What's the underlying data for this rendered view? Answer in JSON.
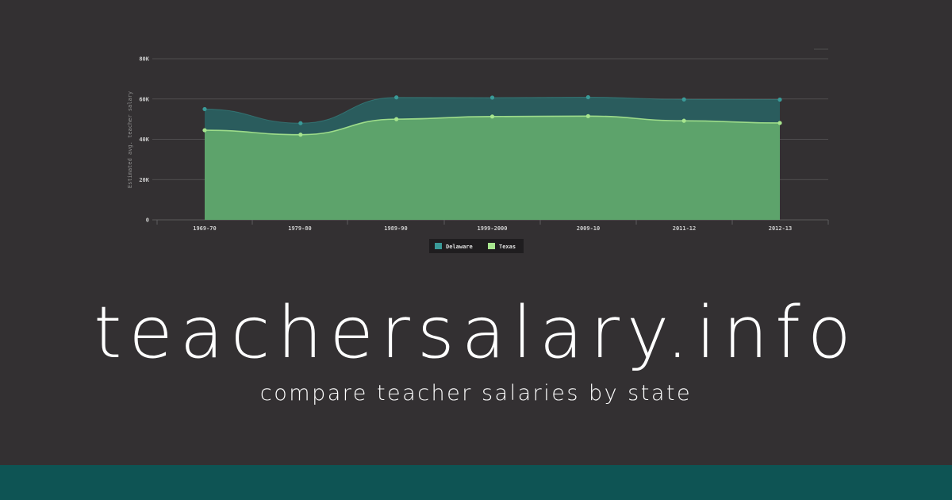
{
  "chart_data": {
    "type": "area",
    "categories": [
      "1969-70",
      "1979-80",
      "1989-90",
      "1999-2000",
      "2009-10",
      "2011-12",
      "2012-13"
    ],
    "series": [
      {
        "name": "Delaware",
        "values": [
          55000,
          48000,
          60800,
          60700,
          60900,
          59800,
          59700
        ]
      },
      {
        "name": "Texas",
        "values": [
          44500,
          42300,
          50000,
          51300,
          51500,
          49200,
          48100
        ]
      }
    ],
    "title": "",
    "xlabel": "",
    "ylabel": "Estimated avg. teacher salary",
    "ylim": [
      0,
      80000
    ],
    "yticks": [
      0,
      20000,
      40000,
      60000,
      80000
    ],
    "ytick_labels": [
      "0",
      "20K",
      "40K",
      "60K",
      "80K"
    ],
    "grid": true,
    "legend_position": "bottom-center"
  },
  "legend": {
    "delaware_label": "Delaware",
    "texas_label": "Texas"
  },
  "site": {
    "title": "teachersalary.info",
    "tagline": "compare teacher salaries by state"
  },
  "colors": {
    "background": "#333032",
    "delaware": "#2a5f60",
    "delaware_point": "#3a9a98",
    "texas": "#5fa56b",
    "texas_line": "#a7e58e",
    "footer": "#0e5454",
    "grid": "#5a585a"
  }
}
